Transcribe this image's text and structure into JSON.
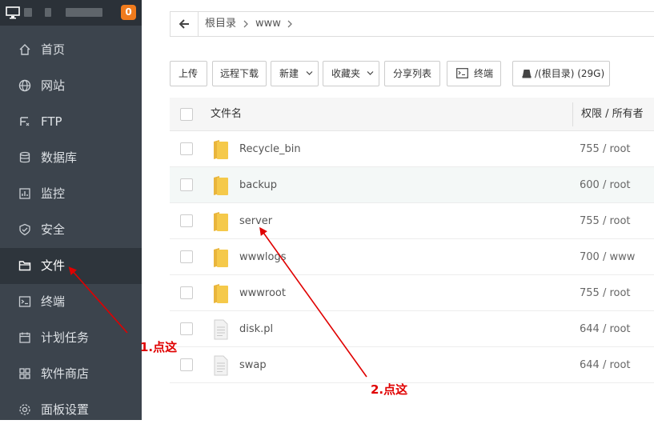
{
  "sidebar": {
    "badge": "0",
    "items": [
      {
        "label": "首页",
        "icon": "home-icon"
      },
      {
        "label": "网站",
        "icon": "globe-icon"
      },
      {
        "label": "FTP",
        "icon": "ftp-icon"
      },
      {
        "label": "数据库",
        "icon": "database-icon"
      },
      {
        "label": "监控",
        "icon": "monitor-chart-icon"
      },
      {
        "label": "安全",
        "icon": "shield-icon"
      },
      {
        "label": "文件",
        "icon": "folder-icon",
        "active": true
      },
      {
        "label": "终端",
        "icon": "terminal-icon"
      },
      {
        "label": "计划任务",
        "icon": "calendar-icon"
      },
      {
        "label": "软件商店",
        "icon": "apps-grid-icon"
      },
      {
        "label": "面板设置",
        "icon": "gear-icon"
      }
    ]
  },
  "breadcrumb": {
    "root": "根目录",
    "dir": "www"
  },
  "toolbar": {
    "upload": "上传",
    "remote_download": "远程下载",
    "new": "新建",
    "favorites": "收藏夹",
    "share_list": "分享列表",
    "terminal": "终端",
    "disk": "/(根目录) (29G)"
  },
  "table": {
    "col_name": "文件名",
    "col_perm": "权限 / 所有者",
    "rows": [
      {
        "name": "Recycle_bin",
        "perm": "755 / root",
        "type": "folder"
      },
      {
        "name": "backup",
        "perm": "600 / root",
        "type": "folder"
      },
      {
        "name": "server",
        "perm": "755 / root",
        "type": "folder"
      },
      {
        "name": "wwwlogs",
        "perm": "700 / www",
        "type": "folder"
      },
      {
        "name": "wwwroot",
        "perm": "755 / root",
        "type": "folder"
      },
      {
        "name": "disk.pl",
        "perm": "644 / root",
        "type": "file"
      },
      {
        "name": "swap",
        "perm": "644 / root",
        "type": "file"
      }
    ]
  },
  "annotations": {
    "step1": "1.点这",
    "step2": "2.点这"
  },
  "colors": {
    "sidebar_bg": "#3c444d",
    "accent_badge": "#f07b1d",
    "folder": "#f5c94a",
    "annotation": "#e00000"
  }
}
